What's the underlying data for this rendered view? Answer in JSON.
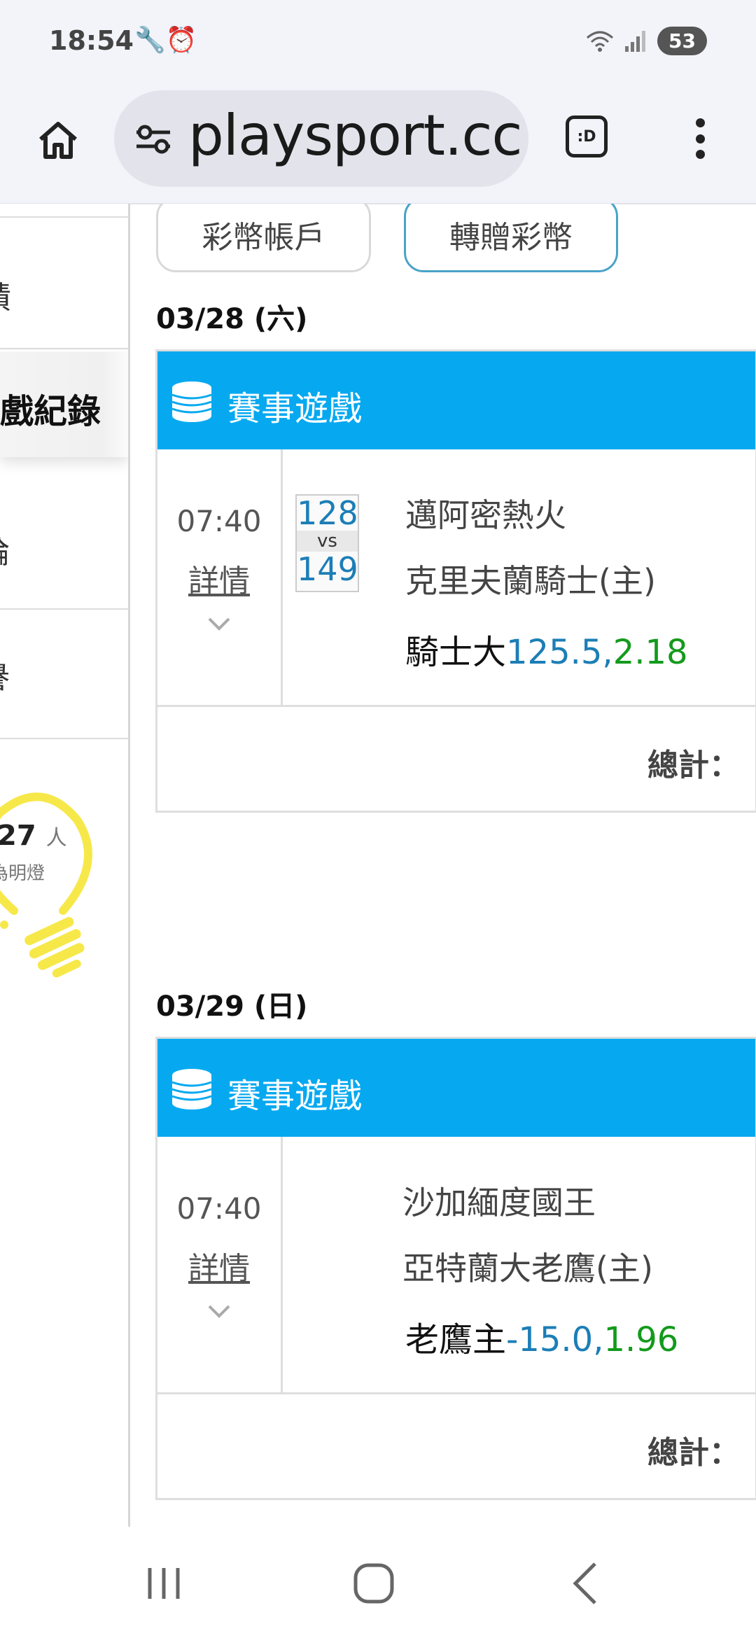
{
  "status_bar": {
    "time": "18:54",
    "left_icons": "🔧⏰",
    "wifi_icon": "wifi-icon",
    "signal_icon": "signal-icon",
    "battery": "53"
  },
  "browser": {
    "url": "playsport.cc",
    "tab_badge": ":D"
  },
  "sidebar": {
    "items": [
      {
        "label": "績"
      },
      {
        "label": "戲紀錄"
      },
      {
        "label": "論"
      },
      {
        "label": "譽"
      }
    ],
    "bulb": {
      "count": "27",
      "unit": "人",
      "label": "為明燈"
    }
  },
  "main": {
    "account_button": "彩幣帳戶",
    "transfer_button": "轉贈彩幣",
    "sections": [
      {
        "date": "03/28 (六)",
        "header": "賽事遊戲",
        "time": "07:40",
        "detail": "詳情",
        "score_away": "128",
        "vs": "vs",
        "score_home": "149",
        "team_away": "邁阿密熱火",
        "team_home": "克里夫蘭騎士(主)",
        "pick_name": "騎士大",
        "pick_line": "125.5,",
        "pick_odds": "2.18",
        "total": "總計："
      },
      {
        "date": "03/29 (日)",
        "header": "賽事遊戲",
        "time": "07:40",
        "detail": "詳情",
        "team_away": "沙加緬度國王",
        "team_home": "亞特蘭大老鷹(主)",
        "pick_name": "老鷹主",
        "pick_line": "-15.0,",
        "pick_odds": "1.96",
        "total": "總計："
      }
    ]
  },
  "colors": {
    "header_blue": "#06a9f0",
    "line_blue": "#1c7eb6",
    "odds_green": "#139a1c",
    "bulb_yellow": "#f7e84a"
  }
}
